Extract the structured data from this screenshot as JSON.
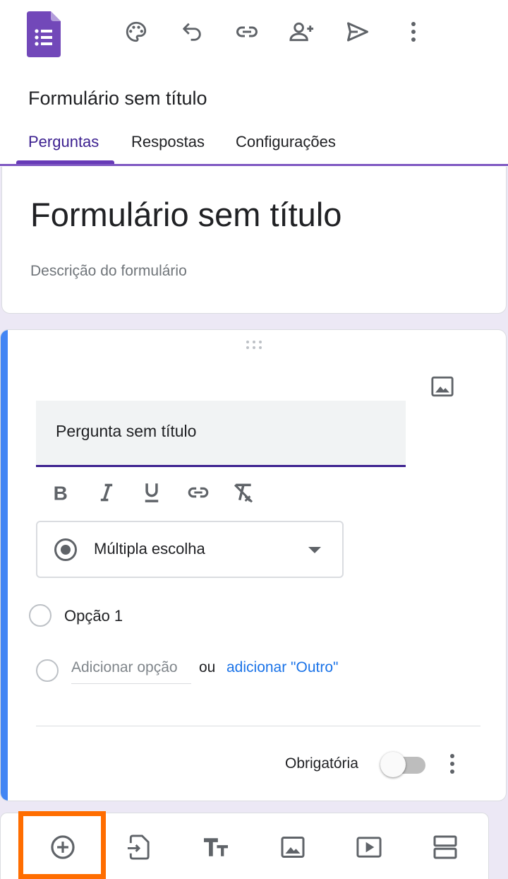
{
  "colors": {
    "accent_purple": "#673ab7",
    "dark_purple": "#3b1f8f",
    "question_accent_blue": "#4285f4",
    "link_blue": "#1a73e8",
    "highlight_orange": "#ff6d00",
    "canvas_bg": "#ece8f5"
  },
  "header": {
    "app_icon": "google-forms-icon",
    "toolbar_icons": [
      "palette-icon",
      "undo-icon",
      "link-icon",
      "add-collaborator-icon",
      "send-icon",
      "more-vert-icon"
    ],
    "document_title": "Formulário sem título"
  },
  "tabs": [
    {
      "label": "Perguntas",
      "active": true
    },
    {
      "label": "Respostas",
      "active": false
    },
    {
      "label": "Configurações",
      "active": false
    }
  ],
  "form": {
    "title": "Formulário sem título",
    "description_placeholder": "Descrição do formulário"
  },
  "question": {
    "title": "Pergunta sem título",
    "format_icons": [
      "bold-icon",
      "italic-icon",
      "underline-icon",
      "insert-link-icon",
      "clear-formatting-icon"
    ],
    "type": "Múltipla escolha",
    "options": [
      "Opção 1"
    ],
    "add_option_placeholder": "Adicionar opção",
    "or_text": "ou",
    "add_other_label": "adicionar \"Outro\"",
    "required_label": "Obrigatória",
    "required": false
  },
  "bottom_toolbar": {
    "icons": [
      "add-question-icon",
      "import-questions-icon",
      "add-title-icon",
      "add-image-icon",
      "add-video-icon",
      "add-section-icon"
    ],
    "highlighted": "add-question-icon"
  }
}
